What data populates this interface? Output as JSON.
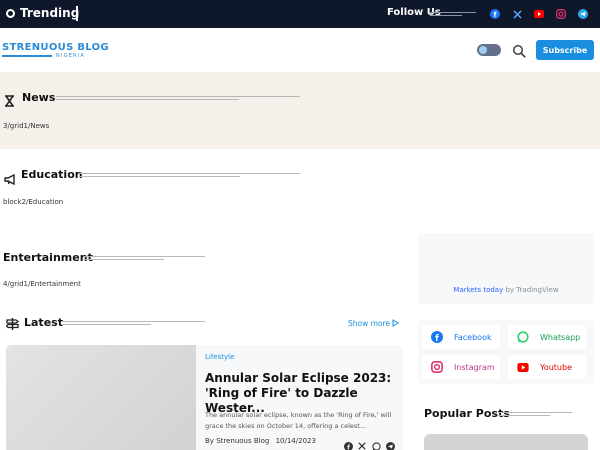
{
  "topbar": {
    "trending_label": "Trending",
    "follow_label": "Follow Us",
    "social_icons": [
      "facebook-icon",
      "x-icon",
      "youtube-icon",
      "instagram-icon",
      "telegram-icon"
    ]
  },
  "header": {
    "logo_main": "STRENUOUS BLOG",
    "logo_sub": "NIGERIA",
    "subscribe_label": "Subscribe"
  },
  "sections": {
    "news": {
      "title": "News",
      "path": "3/grid1/News"
    },
    "education": {
      "title": "Education",
      "path": "block2/Education"
    },
    "entertainment": {
      "title": "Entertainment",
      "path": "4/grid1/Entertainment"
    },
    "latest": {
      "title": "Latest",
      "show_more": "Show more"
    }
  },
  "latest_post": {
    "category": "Lifestyle",
    "title": "Annular Solar Eclipse 2023: 'Ring of Fire' to Dazzle Wester...",
    "excerpt": "The annular solar eclipse, known as the 'Ring of Fire,' will grace the skies on October 14, offering a celest...",
    "author_prefix": "By",
    "author": "Strenuous Blog",
    "date": "10/14/2023"
  },
  "widget": {
    "markets_link": "Markets today",
    "by_text": " by TradingView"
  },
  "social_buttons": {
    "facebook": "Facebook",
    "whatsapp": "Whatsapp",
    "instagram": "Instagram",
    "youtube": "Youtube"
  },
  "popular": {
    "title": "Popular Posts"
  },
  "colors": {
    "topbar": "#0f172a",
    "accent": "#1a8ee0",
    "band": "#f5f1ea",
    "facebook": "#1877f2",
    "whatsapp": "#25d366",
    "youtube": "#ff0000",
    "instagram": "#e1306c",
    "telegram": "#2aabee"
  }
}
